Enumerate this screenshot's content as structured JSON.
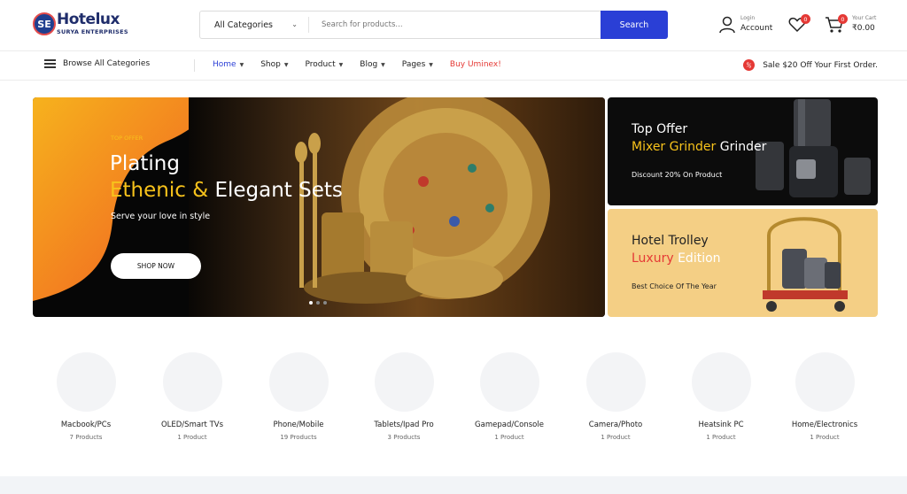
{
  "brand": {
    "mark": "SE",
    "name": "Hotelux",
    "subtitle": "SURYA ENTERPRISES"
  },
  "search": {
    "category_selected": "All Categories",
    "placeholder": "Search for products...",
    "button_label": "Search"
  },
  "account": {
    "small": "Login",
    "label": "Account"
  },
  "wishlist": {
    "count": "0"
  },
  "cart": {
    "count": "0",
    "small": "Your Cart",
    "total": "₹0.00"
  },
  "nav": {
    "browse_label": "Browse All Categories",
    "items": [
      {
        "label": "Home"
      },
      {
        "label": "Shop"
      },
      {
        "label": "Product"
      },
      {
        "label": "Blog"
      },
      {
        "label": "Pages"
      },
      {
        "label": "Buy Uminex!"
      }
    ],
    "sale_text": "Sale $20 Off Your First Order."
  },
  "hero": {
    "tag": "TOP OFFER",
    "line1": "Plating",
    "line2_highlight": "Ethenic &",
    "line2_rest": " Elegant Sets",
    "subtitle": "Serve your love in style",
    "cta": "SHOP NOW"
  },
  "banner_top": {
    "title": "Top Offer",
    "line2_highlight": "Mixer Grinder",
    "line2_rest": " Grinder",
    "caption": "Discount 20% On Product"
  },
  "banner_bottom": {
    "title": "Hotel Trolley",
    "line2_red": "Luxury",
    "line2_white": " Edition",
    "caption": "Best Choice Of The Year"
  },
  "categories": [
    {
      "name": "Macbook/PCs",
      "count": "7 Products"
    },
    {
      "name": "OLED/Smart TVs",
      "count": "1 Product"
    },
    {
      "name": "Phone/Mobile",
      "count": "19 Products"
    },
    {
      "name": "Tablets/Ipad Pro",
      "count": "3 Products"
    },
    {
      "name": "Gamepad/Console",
      "count": "1 Product"
    },
    {
      "name": "Camera/Photo",
      "count": "1 Product"
    },
    {
      "name": "Heatsink PC",
      "count": "1 Product"
    },
    {
      "name": "Home/Electronics",
      "count": "1 Product"
    }
  ],
  "colors": {
    "accent_blue": "#2a3fd6",
    "accent_yellow": "#f7c21b",
    "sale_red": "#e53935",
    "brand_navy": "#1f2d6b"
  }
}
